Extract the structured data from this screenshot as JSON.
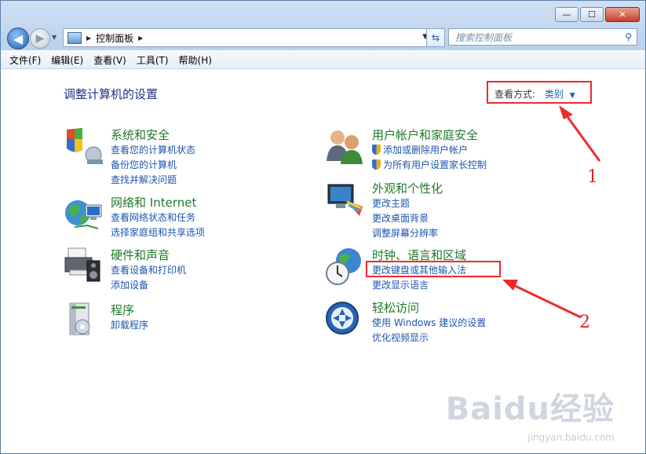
{
  "window": {
    "min_label": "—",
    "max_label": "☐",
    "close_label": "✕"
  },
  "address": {
    "path": "控制面板",
    "search_placeholder": "搜索控制面板"
  },
  "menu": [
    "文件(F)",
    "编辑(E)",
    "查看(V)",
    "工具(T)",
    "帮助(H)"
  ],
  "page": {
    "title": "调整计算机的设置",
    "view_by_label": "查看方式:",
    "view_by_value": "类别"
  },
  "categories": [
    {
      "name": "系统和安全",
      "icon": "shield-computer-icon",
      "links": [
        "查看您的计算机状态",
        "备份您的计算机",
        "查找并解决问题"
      ]
    },
    {
      "name": "网络和 Internet",
      "icon": "network-globe-icon",
      "links": [
        "查看网络状态和任务",
        "选择家庭组和共享选项"
      ]
    },
    {
      "name": "硬件和声音",
      "icon": "printer-speaker-icon",
      "links": [
        "查看设备和打印机",
        "添加设备"
      ]
    },
    {
      "name": "程序",
      "icon": "programs-box-icon",
      "links": [
        "卸载程序"
      ]
    },
    {
      "name": "用户帐户和家庭安全",
      "icon": "users-icon",
      "links": [
        "添加或删除用户帐户",
        "为所有用户设置家长控制"
      ]
    },
    {
      "name": "外观和个性化",
      "icon": "monitor-palette-icon",
      "links": [
        "更改主题",
        "更改桌面背景",
        "调整屏幕分辨率"
      ]
    },
    {
      "name": "时钟、语言和区域",
      "icon": "clock-globe-icon",
      "links": [
        "更改键盘或其他输入法",
        "更改显示语言"
      ]
    },
    {
      "name": "轻松访问",
      "icon": "ease-of-access-icon",
      "links": [
        "使用 Windows 建议的设置",
        "优化视频显示"
      ]
    }
  ],
  "annotations": [
    "1",
    "2"
  ],
  "watermark": {
    "brand": "Baidu经验",
    "url": "jingyan.baidu.com"
  }
}
